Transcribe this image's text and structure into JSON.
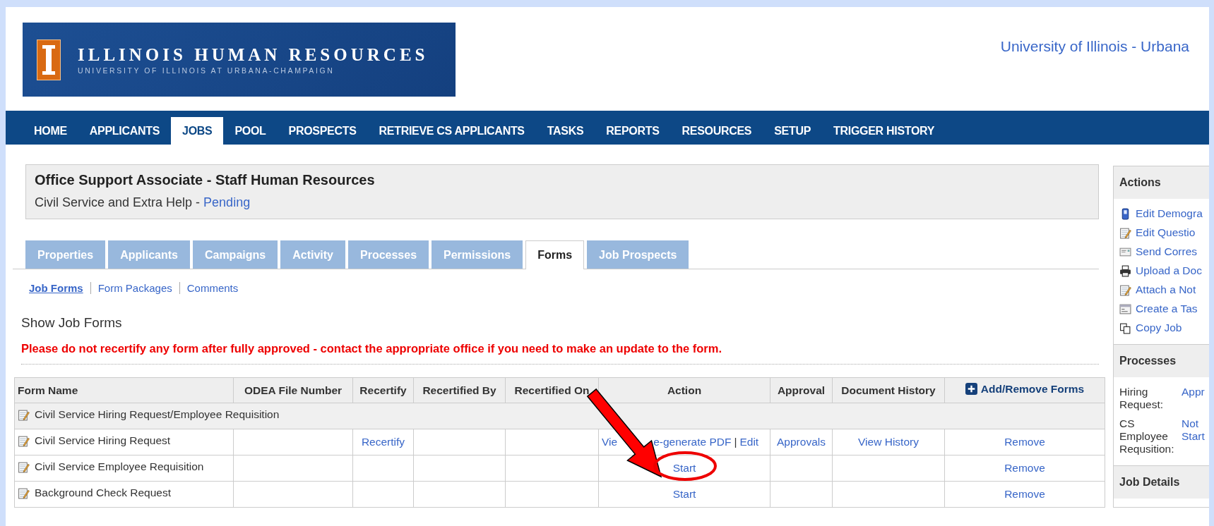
{
  "header": {
    "logo_title": "ILLINOIS HUMAN RESOURCES",
    "logo_subtitle": "UNIVERSITY OF ILLINOIS AT URBANA-CHAMPAIGN",
    "campus": "University of Illinois - Urbana"
  },
  "nav": [
    {
      "label": "HOME",
      "selected": false
    },
    {
      "label": "APPLICANTS",
      "selected": false
    },
    {
      "label": "JOBS",
      "selected": true
    },
    {
      "label": "POOL",
      "selected": false
    },
    {
      "label": "PROSPECTS",
      "selected": false
    },
    {
      "label": "RETRIEVE CS APPLICANTS",
      "selected": false
    },
    {
      "label": "TASKS",
      "selected": false
    },
    {
      "label": "REPORTS",
      "selected": false
    },
    {
      "label": "RESOURCES",
      "selected": false
    },
    {
      "label": "SETUP",
      "selected": false
    },
    {
      "label": "TRIGGER HISTORY",
      "selected": false
    }
  ],
  "job": {
    "title": "Office Support Associate - Staff Human Resources",
    "category": "Civil Service and Extra Help -",
    "status": "Pending"
  },
  "tabs": [
    {
      "label": "Properties",
      "selected": false
    },
    {
      "label": "Applicants",
      "selected": false
    },
    {
      "label": "Campaigns",
      "selected": false
    },
    {
      "label": "Activity",
      "selected": false
    },
    {
      "label": "Processes",
      "selected": false
    },
    {
      "label": "Permissions",
      "selected": false
    },
    {
      "label": "Forms",
      "selected": true
    },
    {
      "label": "Job Prospects",
      "selected": false
    }
  ],
  "subnav": [
    {
      "label": "Job Forms",
      "selected": true
    },
    {
      "label": "Form Packages",
      "selected": false
    },
    {
      "label": "Comments",
      "selected": false
    }
  ],
  "section_title": "Show Job Forms",
  "warning": "Please do not recertify any form after fully approved - contact the appropriate office if you need to make an update to the form.",
  "table": {
    "columns": [
      {
        "label": "Form Name",
        "kind": "text"
      },
      {
        "label": "ODEA File Number",
        "kind": "text"
      },
      {
        "label": "Recertify",
        "kind": "text"
      },
      {
        "label": "Recertified By",
        "kind": "text"
      },
      {
        "label": "Recertified On",
        "kind": "text"
      },
      {
        "label": "Action",
        "kind": "text"
      },
      {
        "label": "Approval",
        "kind": "text"
      },
      {
        "label": "Document History",
        "kind": "text"
      },
      {
        "label": "Add/Remove Forms",
        "kind": "link"
      }
    ],
    "rows": [
      {
        "kind": "group",
        "name": "Civil Service Hiring Request/Employee Requisition"
      },
      {
        "kind": "form",
        "name": "Civil Service Hiring Request",
        "recertify": "Recertify",
        "action": [
          {
            "kind": "link",
            "label": "Vie"
          },
          {
            "kind": "covered"
          },
          {
            "kind": "link",
            "label": "e-generate PDF"
          },
          {
            "kind": "separator",
            "label": "|"
          },
          {
            "kind": "link",
            "label": "Edit"
          }
        ],
        "approval": "Approvals",
        "history": "View History",
        "remove": "Remove"
      },
      {
        "kind": "form",
        "name": "Civil Service Employee Requisition",
        "action": [
          {
            "kind": "link",
            "label": "Start"
          }
        ],
        "remove": "Remove"
      },
      {
        "kind": "form",
        "name": "Background Check Request",
        "action": [
          {
            "kind": "link",
            "label": "Start"
          }
        ],
        "remove": "Remove"
      }
    ]
  },
  "annotations": [
    {
      "kind": "arrow"
    },
    {
      "kind": "circle"
    }
  ],
  "sidebar": [
    {
      "title": "Actions",
      "kind": "links",
      "items": [
        {
          "label": "Edit Demogra"
        },
        {
          "label": "Edit Questio"
        },
        {
          "label": "Send Corres"
        },
        {
          "label": "Upload a Doc"
        },
        {
          "label": "Attach a Not"
        },
        {
          "label": "Create a Tas"
        },
        {
          "label": "Copy Job"
        }
      ]
    },
    {
      "title": "Processes",
      "kind": "pairs",
      "items": [
        {
          "label": "Hiring Request:",
          "value": "Appr"
        },
        {
          "label": "CS Employee Requsition:",
          "value": "Not Start"
        }
      ]
    },
    {
      "title": "Job Details"
    }
  ]
}
